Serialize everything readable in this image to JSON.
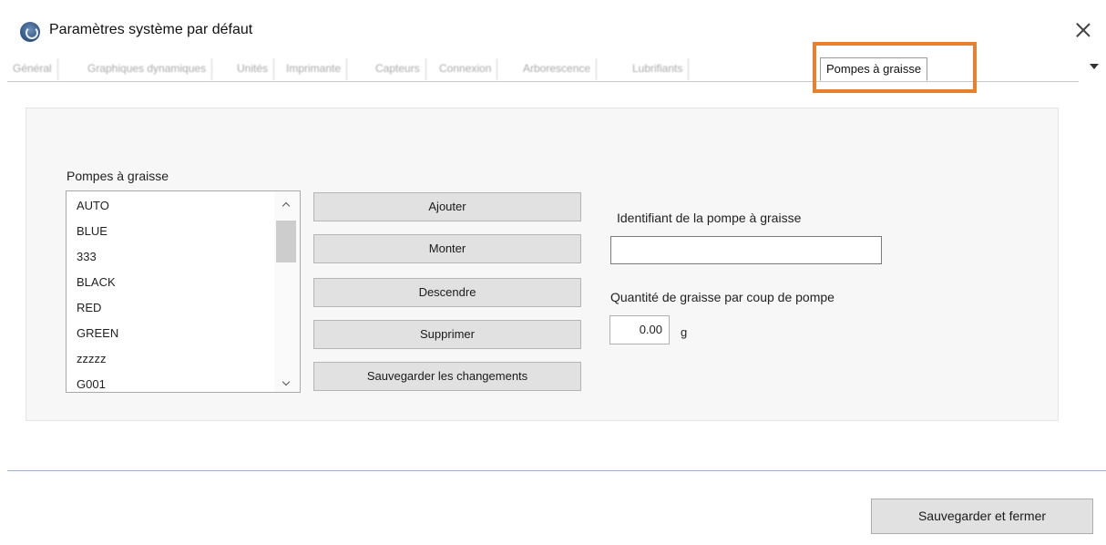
{
  "window": {
    "title": "Paramètres système par défaut",
    "icon": "gauge-app-icon",
    "close_icon": "close-icon"
  },
  "tabs": [
    {
      "label": "Général"
    },
    {
      "label": "Graphiques dynamiques"
    },
    {
      "label": "Unités"
    },
    {
      "label": "Imprimante"
    },
    {
      "label": "Capteurs"
    },
    {
      "label": "Connexion"
    },
    {
      "label": "Arborescence"
    },
    {
      "label": "Lubrifiants"
    },
    {
      "label": "Pompes à graisse"
    }
  ],
  "active_tab": "Pompes à graisse",
  "highlight_color": "#e8812c",
  "pumps": {
    "list_label": "Pompes à graisse",
    "items": [
      "AUTO",
      "BLUE",
      "333",
      "BLACK",
      "RED",
      "GREEN",
      "zzzzz",
      "G001"
    ]
  },
  "buttons": {
    "add": "Ajouter",
    "up": "Monter",
    "down": "Descendre",
    "delete": "Supprimer",
    "save_changes": "Sauvegarder les changements"
  },
  "form": {
    "id_label": "Identifiant de la pompe à graisse",
    "id_value": "",
    "qty_label": "Quantité de graisse par coup de pompe",
    "qty_value": "0.00",
    "qty_unit": "g"
  },
  "footer": {
    "save_close": "Sauvegarder et fermer"
  }
}
